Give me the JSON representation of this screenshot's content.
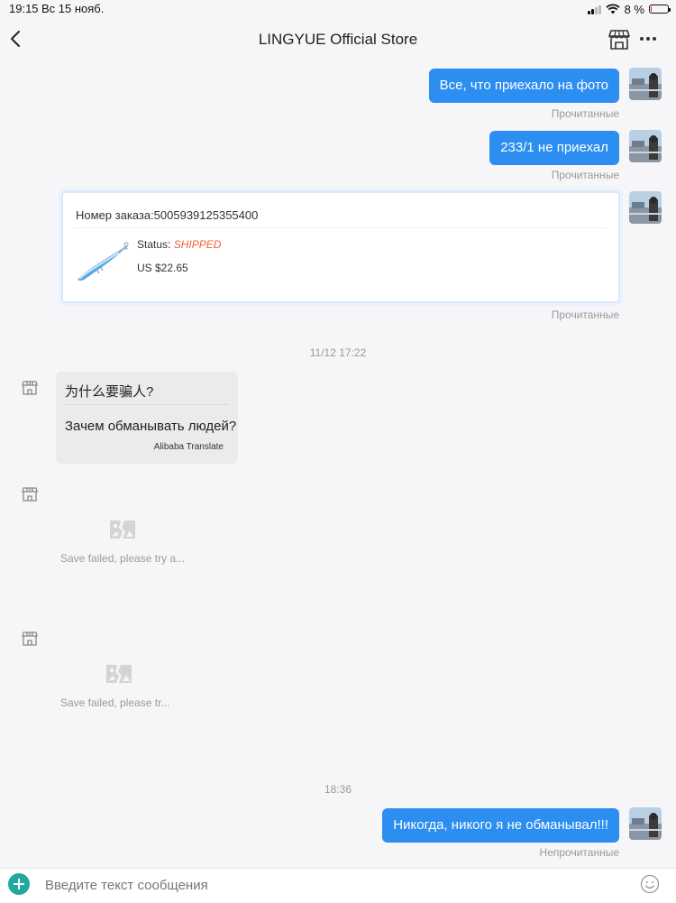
{
  "status_bar": {
    "time": "19:15",
    "date": "Вс 15 нояб.",
    "battery": "8 %",
    "battery_level": 0.08
  },
  "header": {
    "title": "LINGYUE Official Store",
    "back_icon": "chevron-left-icon",
    "store_icon": "storefront-icon",
    "more_icon": "ellipsis-icon"
  },
  "messages": {
    "out1": {
      "text": "Все, что приехало на фото",
      "status": "Прочитанные"
    },
    "out2": {
      "text": "233/1 не приехал",
      "status": "Прочитанные"
    },
    "order": {
      "order_no": "Номер заказа:5005939125355400",
      "status_label": "Status: ",
      "status_value": "SHIPPED",
      "price": "US $22.65",
      "read_status": "Прочитанные"
    },
    "time1": "11/12 17:22",
    "in1": {
      "original": "为什么要骗人?",
      "translation": "Зачем обманывать людей?",
      "attribution": "Alibaba Translate"
    },
    "failed1": "Save failed, please try a...",
    "failed2": "Save failed, please tr...",
    "time2": "18:36",
    "out3": {
      "text": "Никогда, никого я не обманывал!!!",
      "status": "Непрочитанные"
    }
  },
  "input": {
    "placeholder": "Введите текст сообщения"
  },
  "colors": {
    "accent": "#2b8ef0",
    "shipped": "#f06232",
    "plus": "#1fa7a0",
    "battery_low": "#e4262a"
  }
}
